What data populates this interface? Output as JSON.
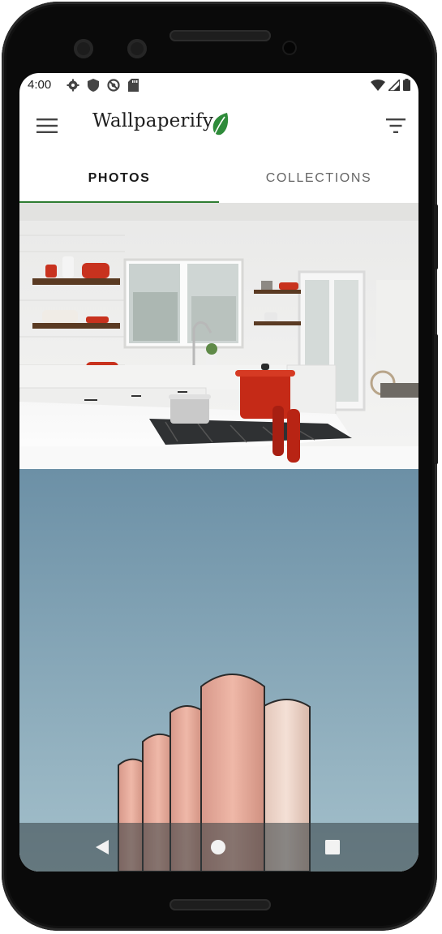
{
  "status_bar": {
    "time": "4:00",
    "left_icons": [
      "gear-icon",
      "shield-icon",
      "do-not-disturb-icon",
      "sd-card-icon"
    ],
    "right_icons": [
      "wifi-icon",
      "cell-signal-icon",
      "battery-icon"
    ]
  },
  "app_bar": {
    "title": "Wallpaperify",
    "menu_icon": "hamburger-menu-icon",
    "logo_icon": "leaf-icon",
    "filter_icon": "filter-icon"
  },
  "tabs": [
    {
      "label": "PHOTOS",
      "selected": true
    },
    {
      "label": "COLLECTIONS",
      "selected": false
    }
  ],
  "photos": [
    {
      "subject": "kitchen"
    },
    {
      "subject": "silos"
    }
  ],
  "nav_bar": {
    "icons": [
      "back-icon",
      "home-icon",
      "recents-icon"
    ]
  },
  "colors": {
    "accent": "#2e7d32",
    "leaf": "#2e8b3a",
    "sky": "#7a9dad"
  }
}
